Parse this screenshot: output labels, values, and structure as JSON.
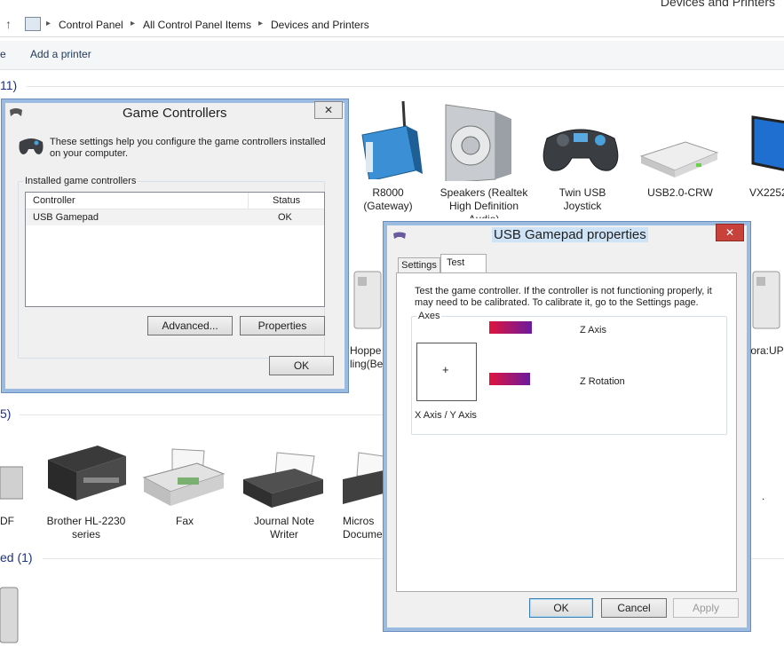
{
  "window": {
    "title": "Devices and Printers"
  },
  "address": {
    "crumbs": [
      "Control Panel",
      "All Control Panel Items",
      "Devices and Printers"
    ]
  },
  "command_bar": {
    "left_partial": "e",
    "add_printer": "Add a printer"
  },
  "groups": {
    "devices_header_partial": "11)",
    "printers_header_partial": "5)",
    "unspecified_header_partial": "ed (1)"
  },
  "devices": [
    {
      "label": "R8000 (Gateway)",
      "icon": "router-icon"
    },
    {
      "label": "Speakers (Realtek High Definition Audio)",
      "icon": "speaker-icon"
    },
    {
      "label": "Twin USB Joystick",
      "icon": "gamepad-icon"
    },
    {
      "label": "USB2.0-CRW",
      "icon": "card-reader-icon"
    },
    {
      "label": "VX2252",
      "icon": "monitor-icon"
    }
  ],
  "devices_row2_partial": [
    {
      "label": "Hoppe\nling(Be",
      "icon": "drive-icon"
    },
    {
      "label": "tora:UP",
      "icon": "drive-icon"
    }
  ],
  "printers": [
    {
      "label": "DF",
      "icon": "printer-icon"
    },
    {
      "label": "Brother HL-2230 series",
      "icon": "laser-printer-icon"
    },
    {
      "label": "Fax",
      "icon": "fax-icon"
    },
    {
      "label": "Journal Note Writer",
      "icon": "printer-icon"
    },
    {
      "label": "Micros\nDocume",
      "icon": "printer-icon"
    }
  ],
  "game_controllers": {
    "title": "Game Controllers",
    "close": "✕",
    "intro": "These settings help you configure the game controllers installed on your computer.",
    "group_label": "Installed game controllers",
    "columns": [
      "Controller",
      "Status"
    ],
    "rows": [
      {
        "controller": "USB Gamepad",
        "status": "OK"
      }
    ],
    "advanced": "Advanced...",
    "properties": "Properties",
    "ok": "OK"
  },
  "gamepad_props": {
    "title": "USB Gamepad properties",
    "close": "✕",
    "tabs": [
      "Settings",
      "Test"
    ],
    "active_tab": "Test",
    "instructions": "Test the game controller.  If the controller is not functioning properly, it may need to be calibrated.  To calibrate it, go to the Settings page.",
    "axes_label": "Axes",
    "xy_label": "X Axis / Y Axis",
    "crosshair": "+",
    "z_axis": "Z Axis",
    "z_rotation": "Z Rotation",
    "ok": "OK",
    "cancel": "Cancel",
    "apply": "Apply",
    "bar_gradient": [
      "#e0143c",
      "#6a1aa0"
    ]
  }
}
